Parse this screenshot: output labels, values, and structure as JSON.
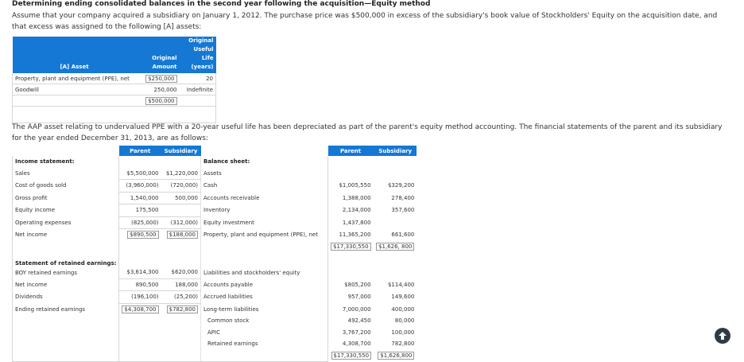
{
  "title": "Determining ending consolidated balances in the second year following the acquisition—Equity method",
  "intro": "Assume that your company acquired a subsidiary on January 1, 2012. The purchase price was $500,000 in excess of the subsidiary's book value of Stockholders' Equity on the acquisition date, and that excess was assigned to the following [A] assets:",
  "asset_table": {
    "headers": [
      "[A] Asset",
      "Original Amount",
      "Original Useful Life (years)"
    ],
    "rows": [
      {
        "asset": "Property, plant and equipment (PPE), net",
        "amount": "$250,000",
        "life": "20"
      },
      {
        "asset": "Goodwill",
        "amount": "250,000",
        "life": "Indefinite"
      }
    ],
    "total": "$500,000"
  },
  "para2": "The AAP asset relating to undervalued PPE with a 20-year useful life has been depreciated as part of the parent's equity method accounting. The financial statements of the parent and its subsidiary for the year ended December 31, 2013, are as follows:",
  "fin": {
    "col_parent": "Parent",
    "col_subsidiary": "Subsidiary",
    "income_title": "Income statement:",
    "balance_title": "Balance sheet:",
    "retained_title": "Statement of retained earnings:",
    "liab_title": "Liabilities and stockholders' equity",
    "income": [
      {
        "label": "Sales",
        "p": "$5,500,000",
        "s": "$1,220,000"
      },
      {
        "label": "Cost of goods sold",
        "p": "(3,960,000)",
        "s": "(720,000)"
      },
      {
        "label": "Gross profit",
        "p": "1,540,000",
        "s": "500,000"
      },
      {
        "label": "Equity income",
        "p": "175,500",
        "s": ""
      },
      {
        "label": "Operating expenses",
        "p": "(825,000)",
        "s": "(312,000)"
      },
      {
        "label": "Net income",
        "p": "$890,500",
        "s": "$188,000"
      }
    ],
    "assets_labels": [
      "Assets",
      "Cash",
      "Accounts receivable",
      "Inventory",
      "Equity investment",
      "Property, plant and equipment (PPE), net"
    ],
    "assets": [
      {
        "p": "",
        "s": ""
      },
      {
        "p": "$1,005,550",
        "s": "$329,200"
      },
      {
        "p": "1,388,000",
        "s": "278,400"
      },
      {
        "p": "2,134,000",
        "s": "357,600"
      },
      {
        "p": "1,437,800",
        "s": ""
      },
      {
        "p": "11,365,200",
        "s": "661,600"
      }
    ],
    "assets_total": {
      "p": "$17,330,550",
      "s": "$1,626, 800"
    },
    "retained": [
      {
        "label": "BOY retained earnings",
        "p": "$3,614,300",
        "s": "$620,000"
      },
      {
        "label": "Net income",
        "p": "890,500",
        "s": "188,000"
      },
      {
        "label": "Dividends",
        "p": "(196,100)",
        "s": "(25,200)"
      },
      {
        "label": "Ending retained earnings",
        "p": "$4,308,700",
        "s": "$782,800"
      }
    ],
    "liab": [
      {
        "label": "Accounts payable",
        "p": "$805,200",
        "s": "$114,400"
      },
      {
        "label": "Accrued liabilities",
        "p": "957,000",
        "s": "149,600"
      },
      {
        "label": "Long-term liabilities",
        "p": "7,000,000",
        "s": "400,000"
      },
      {
        "label": "Common stock",
        "p": "492,450",
        "s": "80,000"
      },
      {
        "label": "APIC",
        "p": "3,767,200",
        "s": "100,000"
      },
      {
        "label": "Retained earnings",
        "p": "4,308,700",
        "s": "782,800"
      }
    ],
    "liab_total": {
      "p": "$17,330,550",
      "s": "$1,626,800"
    }
  },
  "icons": {
    "scroll_top": "arrow-up-icon"
  }
}
